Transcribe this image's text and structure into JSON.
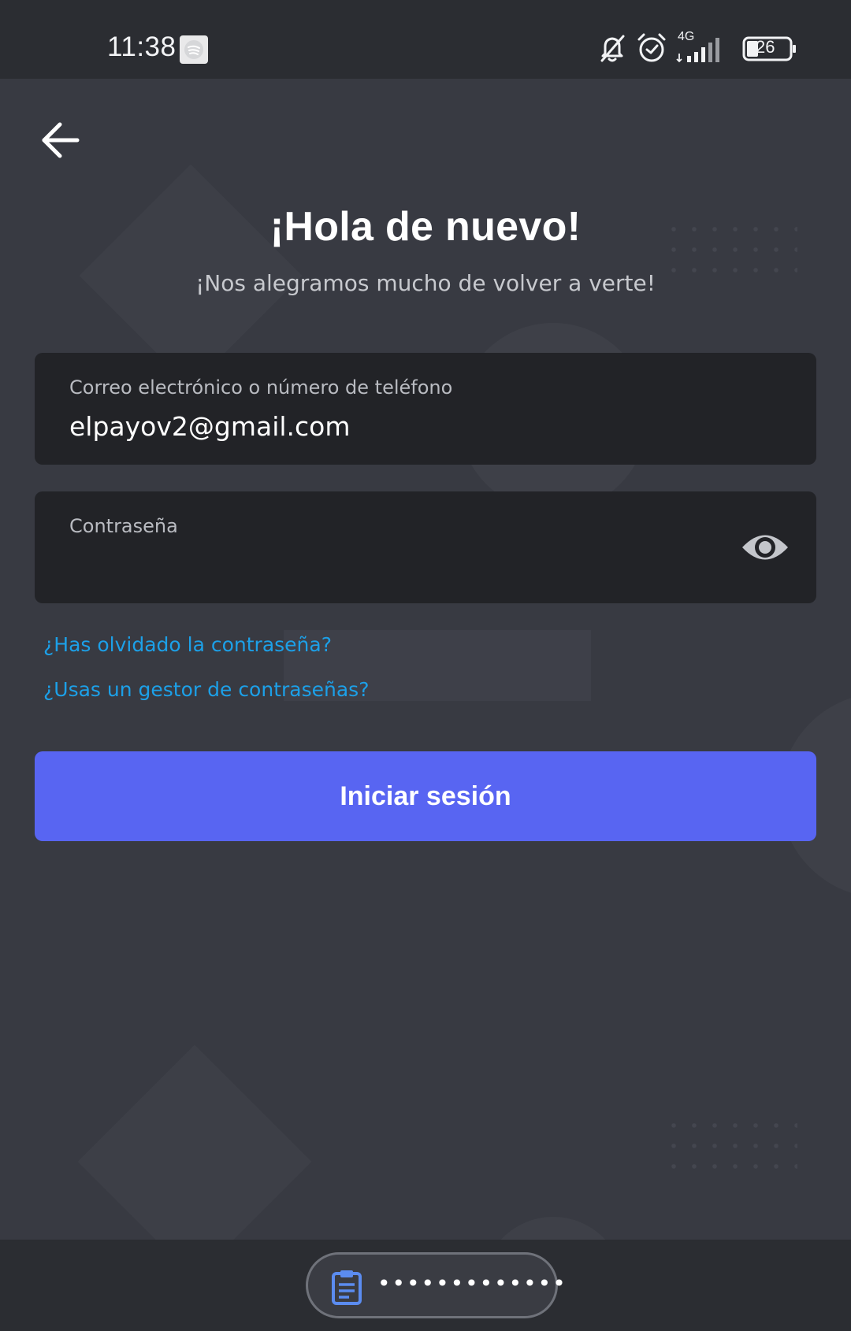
{
  "status_bar": {
    "time": "11:38",
    "network": "4G",
    "battery": "26",
    "icons": [
      "spotify-icon",
      "bell-muted-icon",
      "alarm-icon",
      "signal-icon",
      "battery-icon"
    ]
  },
  "header": {
    "back_icon": "arrow-left-icon"
  },
  "login": {
    "title": "¡Hola de nuevo!",
    "subtitle": "¡Nos alegramos mucho de volver a verte!",
    "email_label": "Correo electrónico o número de teléfono",
    "email_value": "elpayov2@gmail.com",
    "password_label": "Contraseña",
    "password_value": "",
    "password_toggle_icon": "eye-icon",
    "forgot_password_link": "¿Has olvidado la contraseña?",
    "password_manager_link": "¿Usas un gestor de contraseñas?",
    "submit_label": "Iniciar sesión"
  },
  "keyboard_suggestion": {
    "icon": "clipboard-icon",
    "text": "•••••••••••••"
  },
  "colors": {
    "background": "#383a42",
    "field_background": "#222327",
    "accent": "#5865f2",
    "link": "#1ca0e8"
  }
}
